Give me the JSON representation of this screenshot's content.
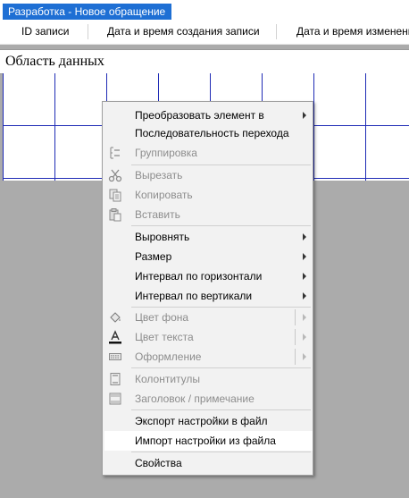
{
  "window": {
    "title": "Разработка - Новое обращение"
  },
  "columns": [
    {
      "label": "ID записи"
    },
    {
      "label": "Дата и время создания записи"
    },
    {
      "label": "Дата и время изменени"
    }
  ],
  "section": {
    "label": "Область данных"
  },
  "context_menu": {
    "items": [
      {
        "label": "Преобразовать элемент в",
        "submenu": true,
        "enabled": true
      },
      {
        "label": "Последовательность перехода",
        "enabled": true
      },
      {
        "label": "Группировка",
        "icon": "grouping-icon",
        "enabled": false
      },
      {
        "label": "Вырезать",
        "icon": "cut-icon",
        "enabled": false
      },
      {
        "label": "Копировать",
        "icon": "copy-icon",
        "enabled": false
      },
      {
        "label": "Вставить",
        "icon": "paste-icon",
        "enabled": false
      },
      {
        "label": "Выровнять",
        "submenu": true,
        "enabled": true
      },
      {
        "label": "Размер",
        "submenu": true,
        "enabled": true
      },
      {
        "label": "Интервал по горизонтали",
        "submenu": true,
        "enabled": true
      },
      {
        "label": "Интервал по вертикали",
        "submenu": true,
        "enabled": true
      },
      {
        "label": "Цвет фона",
        "icon": "fill-color-icon",
        "split_submenu": true,
        "enabled": false
      },
      {
        "label": "Цвет текста",
        "icon": "font-color-icon",
        "split_submenu": true,
        "enabled": false
      },
      {
        "label": "Оформление",
        "icon": "border-style-icon",
        "split_submenu": true,
        "enabled": false
      },
      {
        "label": "Колонтитулы",
        "icon": "page-header-footer-icon",
        "enabled": false
      },
      {
        "label": "Заголовок / примечание",
        "icon": "report-header-footer-icon",
        "enabled": false
      },
      {
        "label": "Экспорт настройки в файл",
        "enabled": true
      },
      {
        "label": "Импорт настройки из файла",
        "enabled": true,
        "highlighted": true
      },
      {
        "label": "Свойства",
        "enabled": true
      }
    ]
  },
  "colors": {
    "title_tab": "#1e6fd4",
    "grid_lines": "#1f2bb5",
    "workspace_background": "#ababab",
    "menu_background": "#f2f2f2"
  }
}
